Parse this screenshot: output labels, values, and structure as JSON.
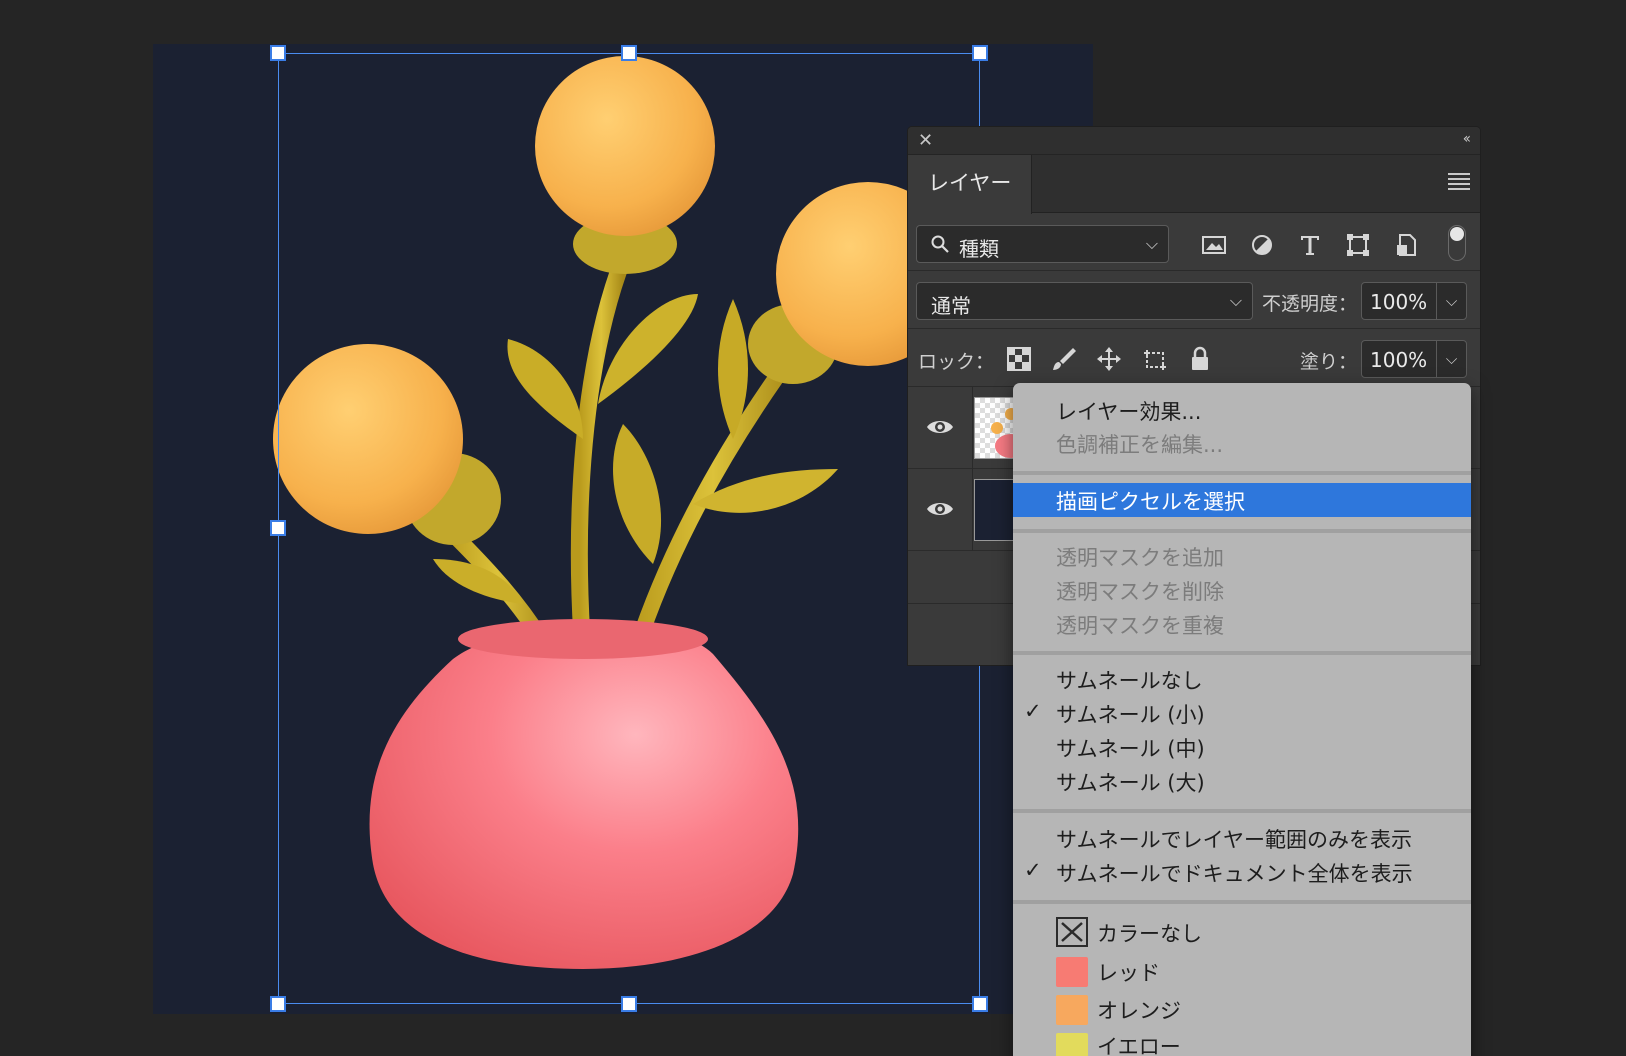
{
  "panel": {
    "close_glyph": "✕",
    "collapse_glyph": "‹‹",
    "tab_label": "レイヤー",
    "filter": {
      "label": "種類",
      "icons": [
        "image-filter-icon",
        "adjustment-filter-icon",
        "type-filter-icon",
        "shape-filter-icon",
        "smart-object-filter-icon"
      ]
    },
    "blend_mode": "通常",
    "opacity_label": "不透明度：",
    "opacity_value": "100%",
    "lock_label": "ロック：",
    "fill_label": "塗り：",
    "fill_value": "100%",
    "lock_icons": [
      "lock-transparent-pixels-icon",
      "lock-image-pixels-icon",
      "lock-position-icon",
      "lock-artboard-icon",
      "lock-all-icon"
    ]
  },
  "context_menu": {
    "items": [
      {
        "label": "レイヤー効果...",
        "disabled": false
      },
      {
        "label": "色調補正を編集...",
        "disabled": true
      },
      {
        "label": "描画ピクセルを選択",
        "selected": true
      },
      {
        "label": "透明マスクを追加",
        "disabled": true
      },
      {
        "label": "透明マスクを削除",
        "disabled": true
      },
      {
        "label": "透明マスクを重複",
        "disabled": true
      },
      {
        "label": "サムネールなし",
        "checked": false
      },
      {
        "label": "サムネール (小)",
        "checked": true
      },
      {
        "label": "サムネール (中)",
        "checked": false
      },
      {
        "label": "サムネール (大)",
        "checked": false
      },
      {
        "label": "サムネールでレイヤー範囲のみを表示",
        "checked": false
      },
      {
        "label": "サムネールでドキュメント全体を表示",
        "checked": true
      }
    ],
    "colors": [
      {
        "label": "カラーなし",
        "color": null
      },
      {
        "label": "レッド",
        "color": "#f77b73"
      },
      {
        "label": "オレンジ",
        "color": "#f7a85e"
      },
      {
        "label": "イエロー",
        "color": "#e2db5c"
      }
    ],
    "check_glyph": "✓"
  },
  "colors": {
    "canvas_bg": "#1b2132",
    "selection_accent": "#2e77dc",
    "bbox_accent": "#4a8cf0"
  }
}
